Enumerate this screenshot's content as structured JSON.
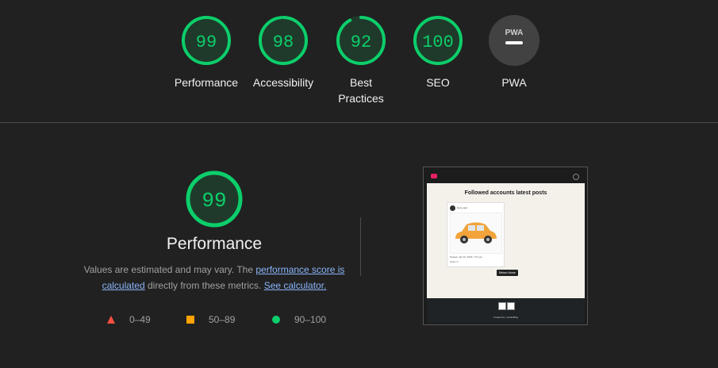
{
  "colors": {
    "background": "#212121",
    "pass": "#0cce6b",
    "average": "#ffa400",
    "fail": "#ff4e42",
    "na": "#424242",
    "link": "#8ab4f8"
  },
  "gauges": [
    {
      "key": "performance",
      "score": "99",
      "value": 99,
      "label": "Performance"
    },
    {
      "key": "accessibility",
      "score": "98",
      "value": 98,
      "label": "Accessibility"
    },
    {
      "key": "best_practices",
      "score": "92",
      "value": 92,
      "label": "Best Practices"
    },
    {
      "key": "seo",
      "score": "100",
      "value": 100,
      "label": "SEO"
    }
  ],
  "pwa": {
    "badge": "PWA",
    "label": "PWA",
    "icon": "pwa-na-icon"
  },
  "performance": {
    "score": "99",
    "value": 99,
    "title": "Performance",
    "desc_prefix": "Values are estimated and may vary. The ",
    "link_score": "performance score is calculated",
    "desc_middle": " directly from these metrics. ",
    "link_calc": "See calculator.",
    "legend": [
      {
        "shape": "triangle",
        "range": "0–49"
      },
      {
        "shape": "square",
        "range": "50–89"
      },
      {
        "shape": "circle",
        "range": "90–100"
      }
    ]
  },
  "thumbnail": {
    "heading": "Followed accounts latest posts",
    "username": "best_user",
    "posted": "Posted: Jan 10, 2023, 7:01 pm",
    "likes": "Likes: 0",
    "return_button": "Return Home",
    "credit": "Created by: winderBlog"
  }
}
